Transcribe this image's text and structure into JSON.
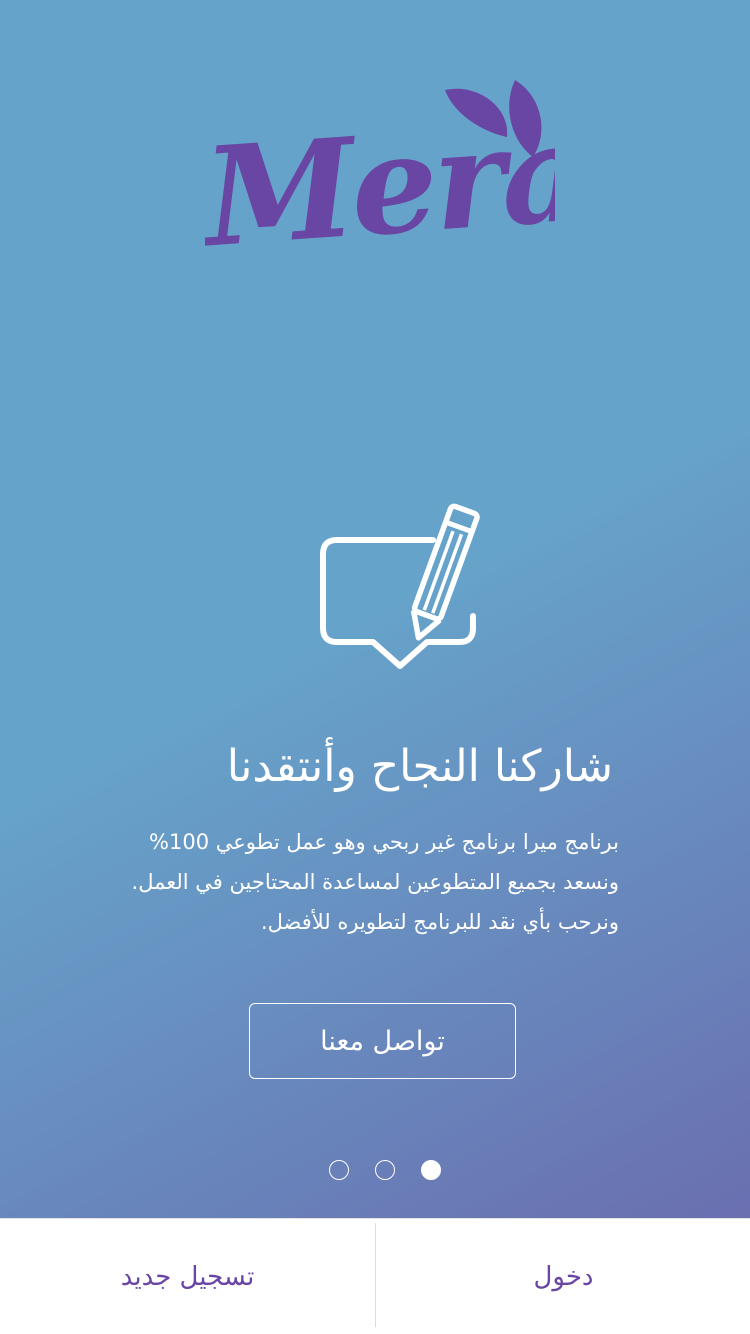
{
  "logo": {
    "text": "Mera",
    "leaf_icon": "leaf-icon"
  },
  "slide": {
    "icon": "edit-note-icon",
    "headline": "شاركنا النجاح وأنتقدنا",
    "body_lines": [
      "برنامج ميرا برنامج غير ربحي وهو عمل تطوعي 100%",
      "ونسعد بجميع المتطوعين لمساعدة المحتاجين في العمل.",
      "ونرحب بأي نقد للبرنامج لتطويره للأفضل."
    ],
    "contact_button": "تواصل معنا"
  },
  "pagination": {
    "count": 3,
    "active_index": 2
  },
  "bottom_bar": {
    "register": "تسجيل جديد",
    "login": "دخول"
  },
  "colors": {
    "brand_purple": "#6a46a4",
    "gradient_start": "#66a3ca",
    "gradient_end": "#6a6fb0"
  }
}
